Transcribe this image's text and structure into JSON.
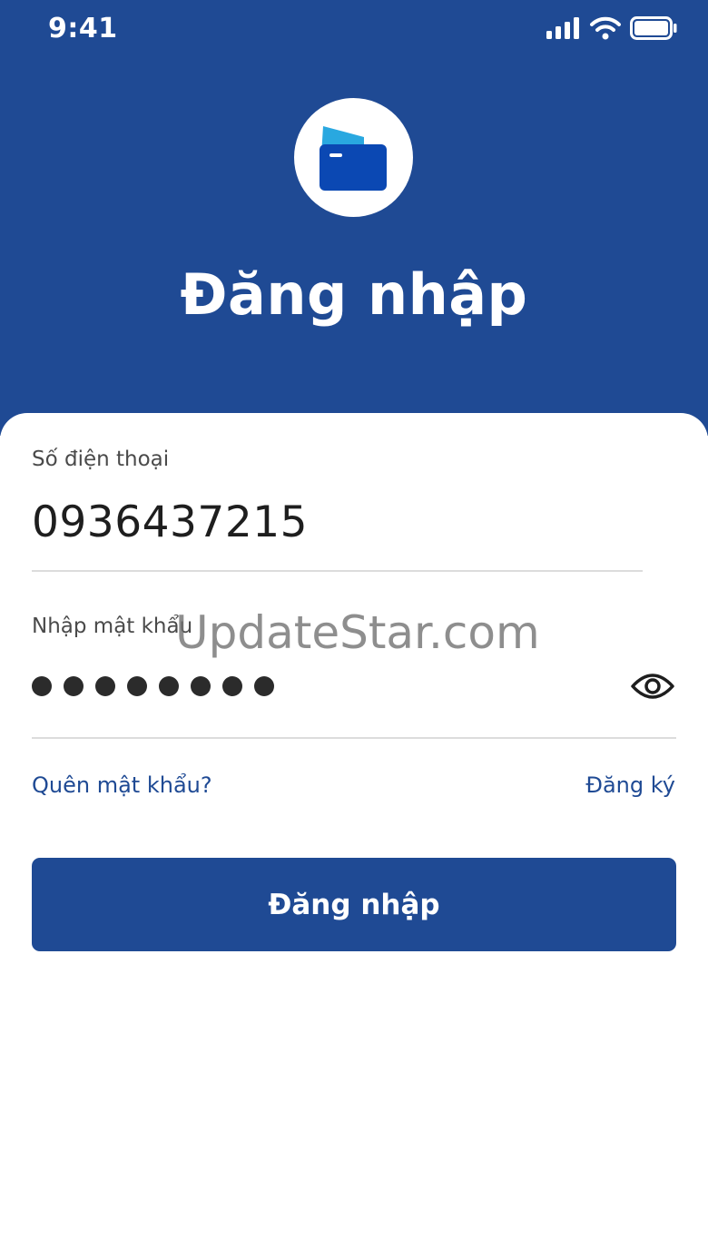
{
  "status_bar": {
    "time": "9:41",
    "icons": [
      "signal-icon",
      "wifi-icon",
      "battery-icon"
    ]
  },
  "header": {
    "logo_icon": "wallet-card-icon",
    "title": "Đăng nhập"
  },
  "form": {
    "phone_label": "Số điện thoại",
    "phone_value": "0936437215",
    "password_label": "Nhập mật khẩu",
    "password_masked_length": 8,
    "visibility_toggle_icon": "eye-icon"
  },
  "links": {
    "forgot_password": "Quên mật khẩu?",
    "register": "Đăng ký"
  },
  "login_button_label": "Đăng nhập",
  "watermark": "UpdateStar.com",
  "colors": {
    "primary": "#1f4a94",
    "accent_light": "#29a8e0",
    "card_blue": "#0b48b3",
    "background": "#ffffff",
    "divider": "#dcdcdc"
  }
}
